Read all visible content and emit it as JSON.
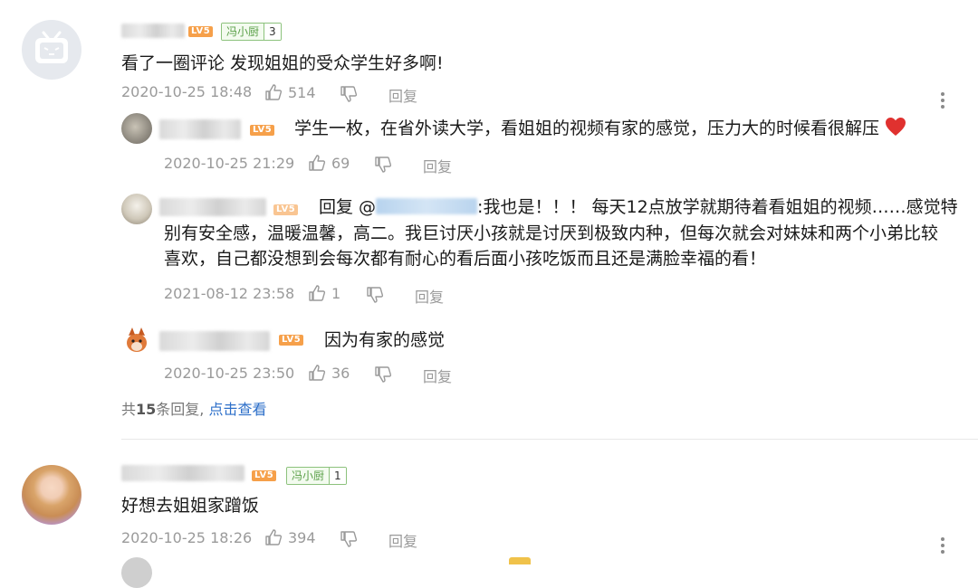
{
  "comments": [
    {
      "level": "LV5",
      "fan_badge": {
        "name": "冯小厨",
        "level": "3"
      },
      "text": "看了一圈评论 发现姐姐的受众学生好多啊!",
      "time": "2020-10-25 18:48",
      "likes": "514",
      "reply_label": "回复",
      "replies": [
        {
          "level": "LV5",
          "text": "学生一枚，在省外读大学，看姐姐的视频有家的感觉，压力大的时候看很解压",
          "time": "2020-10-25 21:29",
          "likes": "69",
          "reply_label": "回复"
        },
        {
          "level": "LV5",
          "reply_prefix": "回复 @",
          "reply_text": ":我也是！！！ 每天12点放学就期待着看姐姐的视频……感觉特",
          "text_line2": "别有安全感，温暖温馨，高二。我巨讨厌小孩就是讨厌到极致内种，但每次就会对妹妹和两个小弟比较",
          "text_line3": "喜欢，自己都没想到会每次都有耐心的看后面小孩吃饭而且还是满脸幸福的看！",
          "time": "2021-08-12 23:58",
          "likes": "1",
          "reply_label": "回复"
        },
        {
          "level": "LV5",
          "text": "因为有家的感觉",
          "time": "2020-10-25 23:50",
          "likes": "36",
          "reply_label": "回复"
        }
      ],
      "more_replies": {
        "prefix": "共",
        "count": "15",
        "suffix": "条回复,",
        "link": "点击查看"
      }
    },
    {
      "level": "LV5",
      "fan_badge": {
        "name": "冯小厨",
        "level": "1"
      },
      "text": "好想去姐姐家蹭饭",
      "time": "2020-10-25 18:26",
      "likes": "394",
      "reply_label": "回复"
    }
  ],
  "colors": {
    "level_badge": "#f6a04a",
    "fan_badge": "#5aa048",
    "link": "#2d6fc9",
    "meta": "#9a9a9a"
  },
  "icons": [
    "thumb-up-icon",
    "thumb-down-icon",
    "more-vertical-icon",
    "heart-icon"
  ]
}
